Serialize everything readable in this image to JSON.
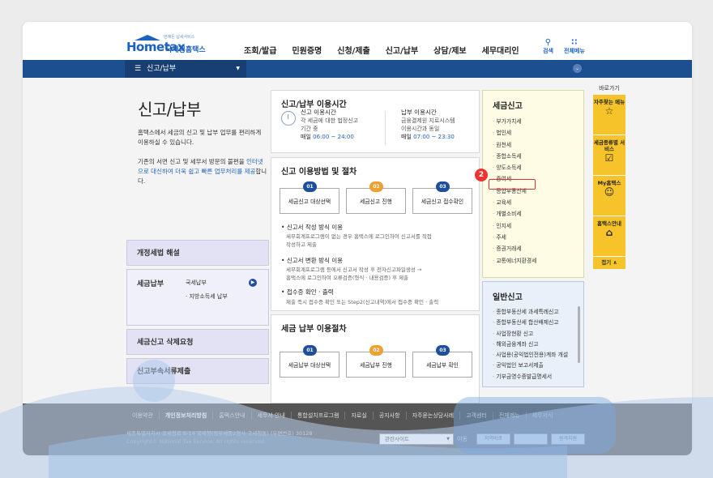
{
  "header": {
    "logo_tagline": "언제든 납세서비스",
    "logo_brand": "Hometax",
    "logo_org": "국세청홈택스",
    "nav": [
      "조회/발급",
      "민원증명",
      "신청/제출",
      "신고/납부",
      "상담/제보",
      "세무대리인"
    ],
    "search_label": "검색",
    "allmenu_label": "전체메뉴"
  },
  "subbar": {
    "crumb": "신고/납부"
  },
  "page": {
    "title": "신고/납부",
    "desc1": "홈택스에서 세금의 신고 및 납부 업무를 편리하게 이용하실 수 있습니다.",
    "desc2a": "기존의 서면 신고 및 세무서 방문의 불편을 ",
    "desc2b": "인터넷으로 대신하여 더욱 쉽고 빠른 업무처리를 제공",
    "desc2c": "합니다."
  },
  "left_menu": {
    "m1": "개정세법 해설",
    "m2": "세금납부",
    "m2_sub1": "국세납부",
    "m2_sub2": "· 지방소득세 납부",
    "m3": "세금신고 삭제요청",
    "m4": "신고부속서류제출"
  },
  "hours": {
    "title": "신고/납부 이용시간",
    "report_label": "신고 이용시간",
    "report_note1": "각 세금에 대한 법정신고",
    "report_note2": "기간 중",
    "report_daily": "매일",
    "report_time": "06:00 ~ 24:00",
    "pay_label": "납부 이용시간",
    "pay_note1": "금융결제원 지로시스템",
    "pay_note2": "이용시간과 동일",
    "pay_daily": "매일",
    "pay_time": "07:00 ~ 23:30"
  },
  "method": {
    "title": "신고 이용방법 및 절차",
    "steps": [
      {
        "n": "01",
        "label": "세금신고 대상선택"
      },
      {
        "n": "02",
        "label": "세금신고 진행"
      },
      {
        "n": "03",
        "label": "세금신고 접수확인"
      }
    ],
    "b1": "신고서 작성 방식 이용",
    "b1_desc1": "세무회계프로그램이 없는 경우 홈택스에 로그인하여 신고서를 직접",
    "b1_desc2": "작성하고 제출",
    "b2": "신고서 변환 방식 이용",
    "b2_desc1": "세무회계프로그램 등에서 신고서 작성 후 전자신고파일생성 →",
    "b2_desc2": "홈택스에 로그인하여 오류검증(형식 · 내용검증) 후 제출",
    "b3": "접수증 확인 · 출력",
    "b3_desc": "제출 즉시 접수증 확인 또는 Step2(신고내역)에서 접수증 확인 · 출력"
  },
  "payment": {
    "title": "세금 납부 이용절차",
    "steps": [
      {
        "n": "01",
        "label": "세금납부 대상선택"
      },
      {
        "n": "02",
        "label": "세금납부 진행"
      },
      {
        "n": "03",
        "label": "세금납부 확인"
      }
    ]
  },
  "tax_report": {
    "title": "세금신고",
    "items": [
      "부가가치세",
      "법인세",
      "원천세",
      "종합소득세",
      "양도소득세",
      "증여세",
      "종합부동산세",
      "교육세",
      "개별소비세",
      "인지세",
      "주세",
      "증권거래세",
      "교통에너지환경세"
    ]
  },
  "general_report": {
    "title": "일반신고",
    "items": [
      "종합부동산세 과세특례신고",
      "종합부동산세 합산배제신고",
      "사업장현황 신고",
      "해외금융계좌 신고",
      "사업용(공익법인전용)계좌 개설",
      "공익법인 보고서제출",
      "기부금영수증발급명세서"
    ]
  },
  "badge": "2",
  "quick": {
    "title": "바로가기",
    "items": [
      "자주찾는 메뉴",
      "세금종류별 서비스",
      "My홈택스",
      "홈택스안내"
    ],
    "close": "접기"
  },
  "footer": {
    "links": [
      "이용약관",
      "개인정보처리방침",
      "홈택스안내",
      "세무서 안내",
      "통합설치프로그램",
      "자료실",
      "공지사항",
      "자주묻는상담사례",
      "고객센터",
      "전체메뉴",
      "세무서식"
    ],
    "address": "세종특별자치시 국세청로 8-14 국세청(정부세종2청사 국세청동) (우편번호) 30128",
    "copyright": "Copyright© National Tax Service. All rights reserved.",
    "select": "관련사이트",
    "go": "이동",
    "banner1": "지역바로",
    "banner2": "",
    "banner3": "원격지원"
  },
  "colors": {
    "brand": "#1e62c0",
    "navbar": "#1b4f8f",
    "tax_panel": "#fefce4",
    "general_panel": "#e9f0fa",
    "quick": "#f6c42a",
    "highlight": "#dd3333"
  }
}
